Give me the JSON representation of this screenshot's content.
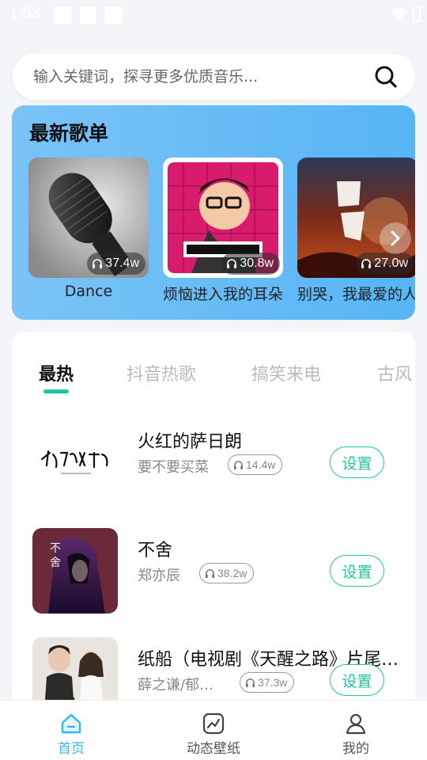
{
  "status_bar": {
    "time": "1:53"
  },
  "search": {
    "placeholder": "输入关键词，探寻更多优质音乐..."
  },
  "playlists": {
    "title": "最新歌单",
    "items": [
      {
        "name": "Dance",
        "plays": "37.4w"
      },
      {
        "name": "烦恼进入我的耳朵",
        "plays": "30.8w"
      },
      {
        "name": "别哭，我最爱的人",
        "plays": "27.0w"
      }
    ]
  },
  "tabs": [
    "最热",
    "抖音热歌",
    "搞笑来电",
    "古风"
  ],
  "songs": [
    {
      "title": "火红的萨日朗",
      "artist": "要不要买菜",
      "plays": "14.4w",
      "action": "设置"
    },
    {
      "title": "不舍",
      "artist": "郑亦辰",
      "plays": "38.2w",
      "action": "设置"
    },
    {
      "title": "纸船（电视剧《天醒之路》片尾曲）",
      "artist": "薛之谦/郁可唯",
      "plays": "37.3w",
      "action": "设置"
    }
  ],
  "bottom_nav": [
    {
      "label": "首页",
      "icon": "home-icon",
      "active": true
    },
    {
      "label": "动态壁纸",
      "icon": "wallpaper-icon",
      "active": false
    },
    {
      "label": "我的",
      "icon": "profile-icon",
      "active": false
    }
  ],
  "colors": {
    "accent": "#1dc79d",
    "nav_active": "#30b8f0",
    "card_blue": "#56b5f5"
  }
}
